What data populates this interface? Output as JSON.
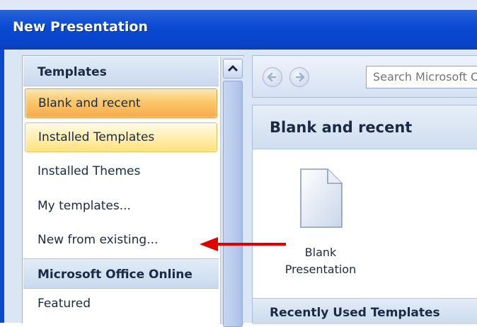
{
  "window": {
    "title": "New Presentation"
  },
  "nav": {
    "header": "Templates",
    "items": [
      {
        "label": "Blank and recent"
      },
      {
        "label": "Installed Templates"
      },
      {
        "label": "Installed Themes"
      },
      {
        "label": "My templates..."
      },
      {
        "label": "New from existing..."
      }
    ],
    "section_header": "Microsoft Office Online",
    "online_items": [
      {
        "label": "Featured"
      }
    ]
  },
  "toolbar": {
    "search_placeholder": "Search Microsoft Office Online"
  },
  "main": {
    "title": "Blank and recent",
    "blank_doc": {
      "label_line1": "Blank",
      "label_line2": "Presentation"
    },
    "recent_header": "Recently Used Templates"
  },
  "colors": {
    "titlebar": "#0a4ad4",
    "selected": "#fbc86a",
    "hover": "#fff0b5",
    "arrow": "#e00000"
  }
}
